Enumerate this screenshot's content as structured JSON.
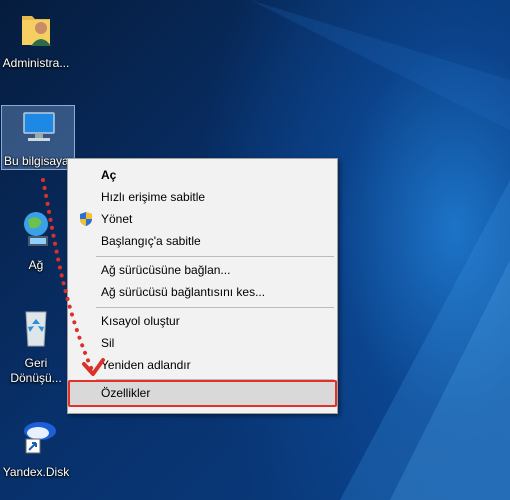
{
  "desktop": {
    "icons": [
      {
        "label": "Administra..."
      },
      {
        "label": "Bu bilgisayar"
      },
      {
        "label": "Ağ"
      },
      {
        "label": "Geri\nDönüşü..."
      },
      {
        "label": "Yandex.Disk"
      }
    ]
  },
  "context_menu": {
    "items": [
      {
        "label": "Aç",
        "bold": true
      },
      {
        "label": "Hızlı erişime sabitle"
      },
      {
        "label": "Yönet",
        "icon": "uac-shield-icon"
      },
      {
        "label": "Başlangıç'a sabitle"
      },
      {
        "label": "Ağ sürücüsüne bağlan..."
      },
      {
        "label": "Ağ sürücüsü bağlantısını kes..."
      },
      {
        "label": "Kısayol oluştur"
      },
      {
        "label": "Sil"
      },
      {
        "label": "Yeniden adlandır"
      },
      {
        "label": "Özellikler",
        "highlighted": true
      }
    ]
  },
  "annotation": {
    "arrow_color": "#d8322b",
    "highlight_color": "#e2302a"
  }
}
